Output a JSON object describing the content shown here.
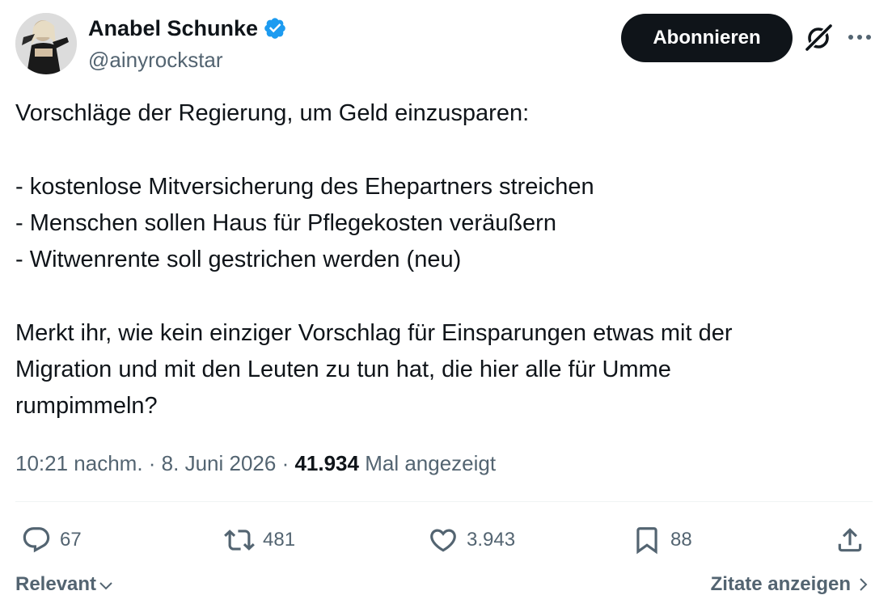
{
  "author": {
    "name": "Anabel Schunke",
    "handle": "@ainyrockstar",
    "verified": true
  },
  "header": {
    "follow_label": "Abonnieren"
  },
  "tweet": {
    "lines": [
      "Vorschläge der Regierung, um Geld einzusparen:",
      "",
      "- kostenlose Mitversicherung des Ehepartners streichen",
      "- Menschen sollen Haus für Pflegekosten veräußern",
      "- Witwenrente soll gestrichen werden (neu)",
      "",
      "Merkt ihr, wie kein einziger Vorschlag für Einsparungen etwas mit der",
      "Migration und mit den Leuten zu tun hat, die hier alle für Umme",
      "rumpimmeln?"
    ]
  },
  "meta": {
    "time": "10:21 nachm.",
    "separator": " · ",
    "date": "8. Juni 2026",
    "views_count": "41.934",
    "views_label": "Mal angezeigt"
  },
  "actions": {
    "replies": "67",
    "reposts": "481",
    "likes": "3.943",
    "bookmarks": "88"
  },
  "footer": {
    "sort_label": "Relevant",
    "quotes_label": "Zitate anzeigen"
  },
  "colors": {
    "text": "#0f1419",
    "secondary": "#536471",
    "verified": "#1d9bf0",
    "button_bg": "#0f1419",
    "divider": "#eff3f4"
  },
  "icons": [
    "verified-badge-icon",
    "grok-icon",
    "more-icon",
    "reply-icon",
    "repost-icon",
    "like-icon",
    "bookmark-icon",
    "share-icon",
    "chevron-down-icon",
    "chevron-right-icon"
  ]
}
